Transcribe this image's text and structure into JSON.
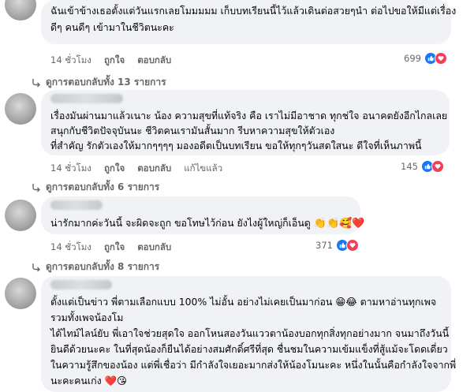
{
  "comments": [
    {
      "lines": [
        "ฉันเข้าข้างเธอตั้งแต่วันแรกเลยโมมมมม เก็บบทเรียนนี้ไว้แล้วเดินต่อสวยๆนำ ต่อไปขอให้มีแต่เรื่อง",
        "ดีๆ คนดีๆ เข้ามาในชีวิตนะคะ"
      ],
      "time": "14 ชั่วโมง",
      "like": "ถูกใจ",
      "reply": "ตอบกลับ",
      "reactions": "699",
      "replies": "ดูการตอบกลับทั้ง 13 รายการ"
    },
    {
      "lines": [
        "เรื่องมันผ่านมาแล้วเนาะ น้อง ความสุขที่แท้จริง คือ เราไม่มีอาชาด ทุกช่ใจ อนาคตยังอีกไกลเลย",
        "สนุกกับชีวิตปัจจุบันนะ ชีวิตคนเรามันสั้นมาก รีบหาความสุขให้ตัวเอง",
        "ที่สำคัญ รักตัวเองให้มากๆๆๆๆ มองอดีตเป็นบทเรียน ขอให้ทุกๆวันสดใสนะ ดีใจที่เห็นภาพนี้"
      ],
      "time": "14 ชั่วโมง",
      "like": "ถูกใจ",
      "reply": "ตอบกลับ",
      "edited": "แก้ไขแล้ว",
      "reactions": "145",
      "replies": "ดูการตอบกลับทั้ง 6 รายการ"
    },
    {
      "lines": [
        "น่ารักมากค่ะวันนี้ จะผิดจะถูก ขอโทษไว้ก่อน ยังไงผู้ใหญ่ก็เอ็นดู"
      ],
      "emojis": "👏👏🥰❤️",
      "time": "14 ชั่วโมง",
      "like": "ถูกใจ",
      "reply": "ตอบกลับ",
      "reactions": "371",
      "replies": "ดูการตอบกลับทั้ง 8 รายการ"
    },
    {
      "lines": [
        "ตั้งแต่เป็นข่าว พี่ตามเลือกแบบ 100% ไม่อั้น อย่างไม่เคยเป็นมาก่อน 😁😂 ตามหาอ่านทุกเพจ",
        "รวมทั้งเพจน้องโม",
        "ได้ไทม์ไลน์ยับ พี่เอาใจช่วยสุดใจ ออกโหนสองวันแววตาน้องบอกทุกสิ่งทุกอย่างมาก จนมาถึงวันนี้",
        "ยินดีด้วยนะคะ ในที่สุดน้องก็ยืนได้อย่างสมศักดิ์ศรีที่สุด ชื่นชมในความเข้มแข็งที่สู้แม้จะโดดเดี่ยว",
        "ในความรู้สึกของน้อง แต่พี่เชื่อว่า มีกำลังใจเยอะมากส่งให้น้องโมนะคะ หนึ่งในนั้นคือกำลังใจจากพี่",
        "นะคะคนเก่ง ❤️😘"
      ]
    }
  ]
}
